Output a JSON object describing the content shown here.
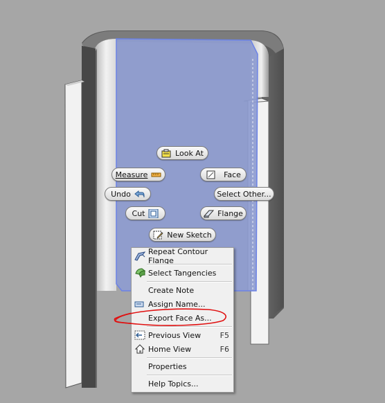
{
  "marking_menu": {
    "look_at": "Look At",
    "measure": "Measure",
    "face": "Face",
    "undo": "Undo",
    "select_other": "Select Other...",
    "cut": "Cut",
    "flange": "Flange",
    "new_sketch": "New Sketch"
  },
  "context_menu": {
    "items": [
      {
        "label": "Repeat Contour Flange",
        "shortcut": "",
        "icon": "contour-flange-icon"
      },
      {
        "label": "Select Tangencies",
        "shortcut": "",
        "icon": "tangencies-icon"
      },
      {
        "label": "Create Note",
        "shortcut": "",
        "icon": ""
      },
      {
        "label": "Assign Name...",
        "shortcut": "",
        "icon": "assign-name-icon"
      },
      {
        "label": "Export Face As...",
        "shortcut": "",
        "icon": ""
      },
      {
        "label": "Previous View",
        "shortcut": "F5",
        "icon": "previous-view-icon"
      },
      {
        "label": "Home View",
        "shortcut": "F6",
        "icon": "home-view-icon"
      },
      {
        "label": "Properties",
        "shortcut": "",
        "icon": ""
      },
      {
        "label": "Help Topics...",
        "shortcut": "",
        "icon": ""
      }
    ]
  },
  "colors": {
    "background": "#a6a6a6",
    "selected_face": "#8e9cd0",
    "annotation_red": "#e01010"
  }
}
